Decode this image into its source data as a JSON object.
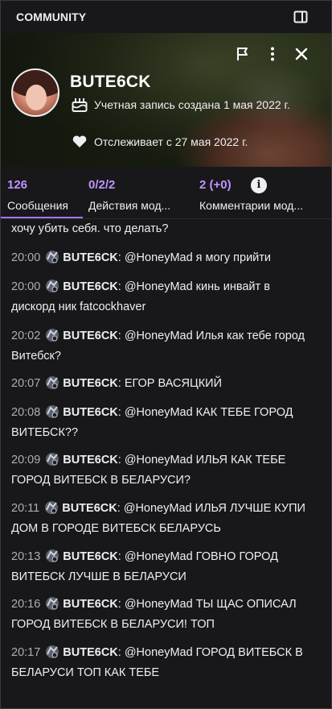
{
  "header": {
    "title": "COMMUNITY"
  },
  "profile": {
    "username": "BUTE6CK",
    "created": "Учетная запись создана 1 мая 2022 г.",
    "following": "Отслеживает с 27 мая 2022 г."
  },
  "tabs": [
    {
      "count": "126",
      "label": "Сообщения"
    },
    {
      "count": "0/2/2",
      "label": "Действия мод..."
    },
    {
      "count": "2 (+0)",
      "label": "Комментарии мод..."
    }
  ],
  "cut_message": "хочу убить себя. что делать?",
  "messages": [
    {
      "time": "20:00",
      "user": "BUTE6CK",
      "text": "@HoneyMad я могу прийти"
    },
    {
      "time": "20:00",
      "user": "BUTE6CK",
      "text": "@HoneyMad кинь инвайт в дискорд ник fatcockhaver"
    },
    {
      "time": "20:02",
      "user": "BUTE6CK",
      "text": "@HoneyMad Илья как тебе город Витебск?"
    },
    {
      "time": "20:07",
      "user": "BUTE6CK",
      "text": "ЕГОР ВАСЯЦКИЙ"
    },
    {
      "time": "20:08",
      "user": "BUTE6CK",
      "text": "@HoneyMad КАК ТЕБЕ ГОРОД ВИТЕБСК??"
    },
    {
      "time": "20:09",
      "user": "BUTE6CK",
      "text": "@HoneyMad ИЛЬЯ КАК ТЕБЕ ГОРОД ВИТЕБСК В БЕЛАРУСИ?"
    },
    {
      "time": "20:11",
      "user": "BUTE6CK",
      "text": "@HoneyMad ИЛЬЯ ЛУЧШЕ КУПИ ДОМ В ГОРОДЕ ВИТЕБСК БЕЛАРУСЬ"
    },
    {
      "time": "20:13",
      "user": "BUTE6CK",
      "text": "@HoneyMad ГОВНО ГОРОД ВИТЕБСК ЛУЧШЕ В БЕЛАРУСИ"
    },
    {
      "time": "20:16",
      "user": "BUTE6CK",
      "text": "@HoneyMad ТЫ ЩАС ОПИСАЛ ГОРОД ВИТЕБСК В БЕЛАРУСИ! ТОП"
    },
    {
      "time": "20:17",
      "user": "BUTE6CK",
      "text": "@HoneyMad ГОРОД ВИТЕБСК В БЕЛАРУСИ ТОП КАК ТЕБЕ"
    }
  ],
  "icons": {
    "collapse": "collapse-panel-icon",
    "flag": "flag-icon",
    "more": "more-vertical-icon",
    "close": "close-icon",
    "created": "cake-icon",
    "following": "heart-icon",
    "info": "info-icon",
    "badge": "user-badge-icon"
  },
  "colors": {
    "accent": "#a970ff",
    "accent_text": "#bf94ff",
    "background": "#18181b"
  }
}
